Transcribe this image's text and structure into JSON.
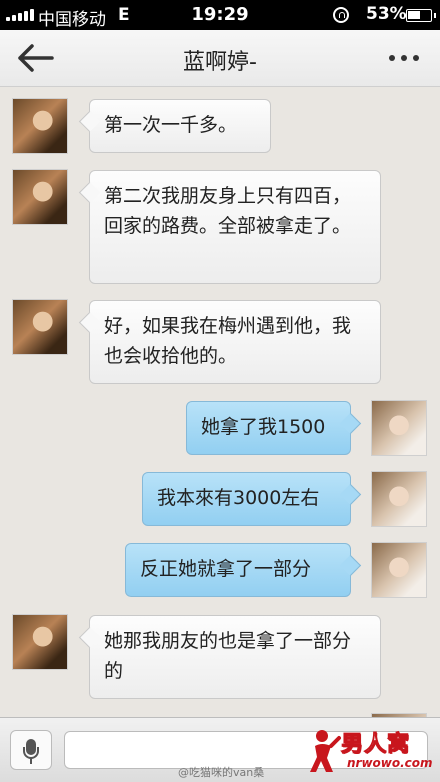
{
  "status_bar": {
    "carrier": "中国移动",
    "network": "E",
    "time": "19:29",
    "battery": "53%"
  },
  "header": {
    "title": "蓝啊婷-"
  },
  "messages": [
    {
      "side": "in",
      "text": "第一次一千多。"
    },
    {
      "side": "in",
      "text": "第二次我朋友身上只有四百，回家的路费。全部被拿走了。"
    },
    {
      "side": "in",
      "text": "好，如果我在梅州遇到他，我也会收拾他的。"
    },
    {
      "side": "out",
      "text": "她拿了我1500"
    },
    {
      "side": "out",
      "text": "我本來有3000左右"
    },
    {
      "side": "out",
      "text": "反正她就拿了一部分"
    },
    {
      "side": "in",
      "text": "她那我朋友的也是拿了一部分的"
    }
  ],
  "input": {
    "value": "",
    "placeholder": ""
  },
  "watermark": {
    "text": "@吃猫咪的van桑",
    "logo_cn": "男人窝",
    "logo_en": "nrwowo.com"
  },
  "colors": {
    "incoming_bubble": "#f4f4f4",
    "outgoing_bubble": "#a6d9f5",
    "logo_red": "#c8161d"
  }
}
